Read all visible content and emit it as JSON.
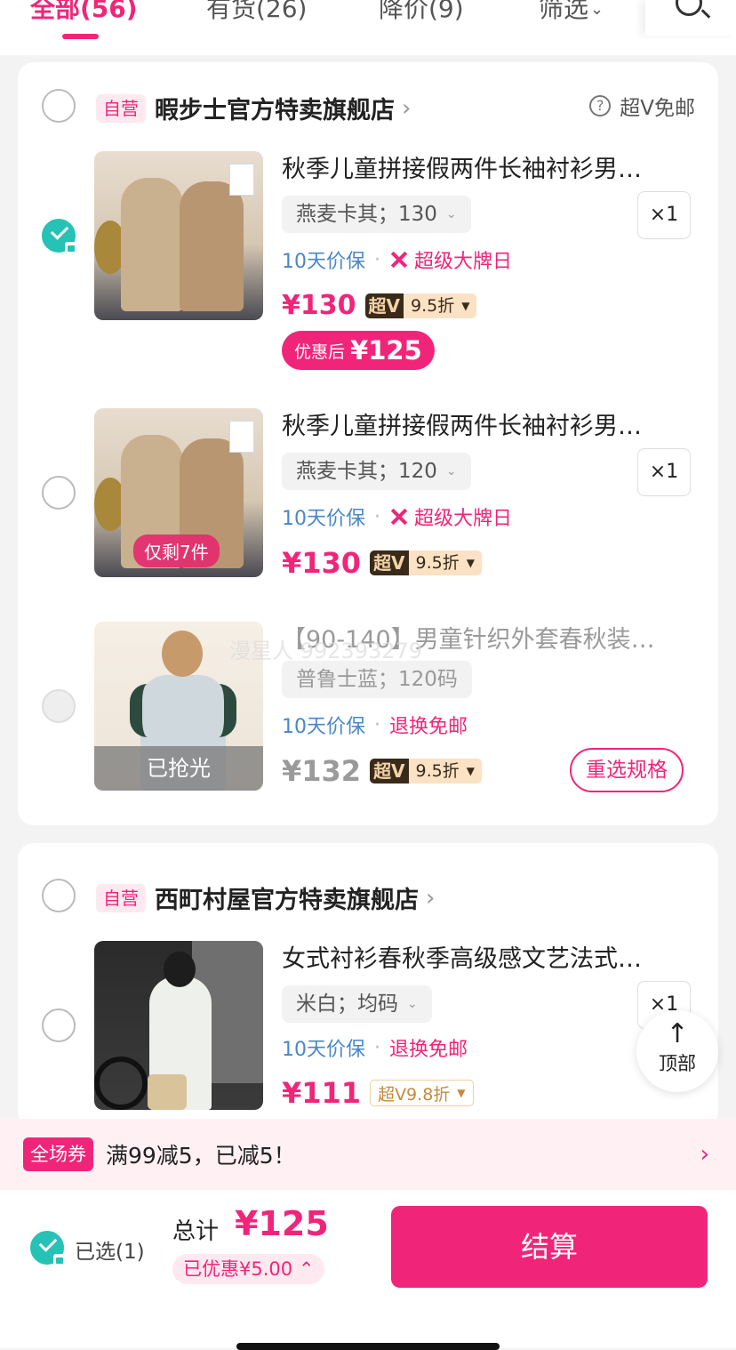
{
  "tabs": [
    {
      "label": "全部(56)"
    },
    {
      "label": "有货(26)"
    },
    {
      "label": "降价(9)"
    },
    {
      "label": "筛选"
    }
  ],
  "store1": {
    "badge": "自营",
    "name": "暇步士官方特卖旗舰店",
    "free_shipping": "超V免邮",
    "items": [
      {
        "title": "秋季儿童拼接假两件长袖衬衫男…",
        "sku": "燕麦卡其；130",
        "qty": "×1",
        "guarantee": "10天价保",
        "tag": "超级大牌日",
        "price": "¥130",
        "superv_label": "超V",
        "discount": "9.5折",
        "after_label": "优惠后",
        "after_price": "¥125"
      },
      {
        "title": "秋季儿童拼接假两件长袖衬衫男…",
        "sku": "燕麦卡其；120",
        "qty": "×1",
        "guarantee": "10天价保",
        "tag": "超级大牌日",
        "price": "¥130",
        "superv_label": "超V",
        "discount": "9.5折",
        "stock_note": "仅剩7件"
      },
      {
        "title": "【90-140】男童针织外套春秋装…",
        "sku": "普鲁士蓝；120码",
        "guarantee": "10天价保",
        "tag": "退换免邮",
        "price": "¥132",
        "superv_label": "超V",
        "discount": "9.5折",
        "sold_out": "已抢光",
        "reselect": "重选规格"
      }
    ]
  },
  "store2": {
    "badge": "自营",
    "name": "西町村屋官方特卖旗舰店",
    "items": [
      {
        "title": "女式衬衫春秋季高级感文艺法式…",
        "sku": "米白；均码",
        "qty": "×1",
        "guarantee": "10天价保",
        "tag": "退换免邮",
        "price": "¥111",
        "superv_discount": "超V9.8折"
      }
    ]
  },
  "watermark": "漫星人 992393279",
  "float_top": {
    "arrow": "↑",
    "label": "顶部"
  },
  "coupon": {
    "badge": "全场券",
    "text": "满99减5，已减5！"
  },
  "footer": {
    "selected": "已选(1)",
    "total_label": "总计",
    "total": "¥125",
    "saved": "已优惠¥5.00",
    "checkout": "结算"
  },
  "colors": {
    "accent": "#f0257a",
    "check": "#26c2b5",
    "link": "#4a87c7"
  }
}
